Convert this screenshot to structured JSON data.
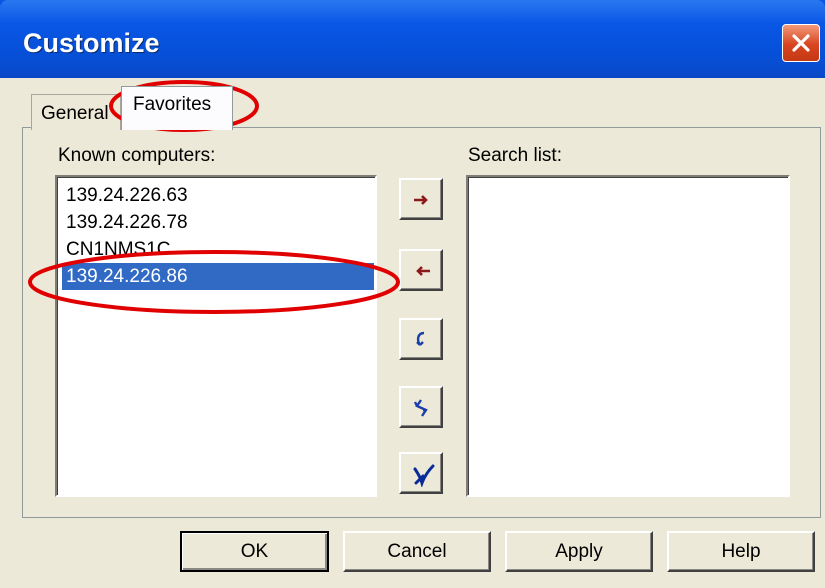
{
  "window": {
    "title": "Customize",
    "close_icon": "close-icon"
  },
  "tabs": [
    {
      "label": "General",
      "active": false
    },
    {
      "label": "Favorites",
      "active": true
    }
  ],
  "known_computers": {
    "label": "Known computers:",
    "items": [
      "139.24.226.63",
      "139.24.226.78",
      "CN1NMS1C",
      "139.24.226.86"
    ],
    "selected": "139.24.226.86"
  },
  "search_list": {
    "label": "Search list:",
    "items": []
  },
  "side_buttons": [
    {
      "icon": "arrow-right-icon"
    },
    {
      "icon": "arrow-left-icon"
    },
    {
      "icon": "move-up-icon"
    },
    {
      "icon": "move-down-icon"
    },
    {
      "icon": "delete-icon"
    }
  ],
  "buttons": {
    "ok": "OK",
    "cancel": "Cancel",
    "apply": "Apply",
    "help": "Help"
  },
  "colors": {
    "titlebar": "#0a57e6",
    "selection": "#316ac5",
    "dialog_bg": "#ece9d8",
    "annotation": "#e00000"
  }
}
